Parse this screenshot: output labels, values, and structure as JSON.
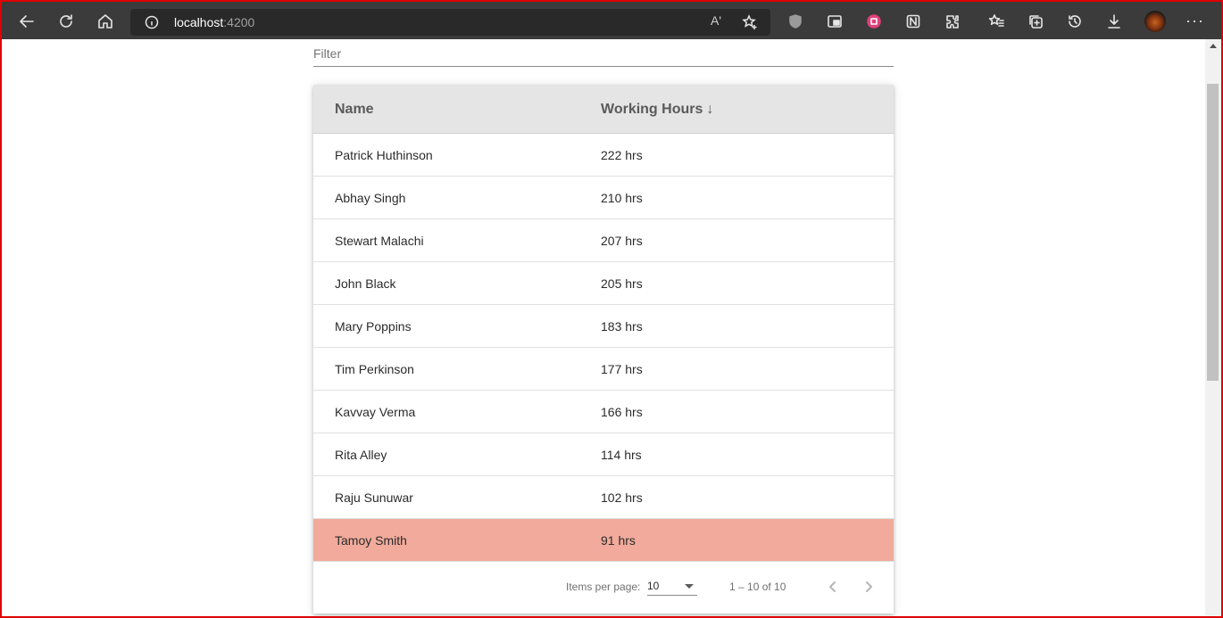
{
  "browser": {
    "url_host": "localhost",
    "url_port": ":4200",
    "read_aloud_label": "Aʹ",
    "menu_label": "···",
    "icons": [
      "back-icon",
      "refresh-icon",
      "home-icon",
      "info-icon",
      "add-favorite-icon",
      "ublock-icon",
      "media-icon",
      "extension-pink-icon",
      "notion-icon",
      "extensions-icon",
      "favorites-icon",
      "collections-icon",
      "history-icon",
      "downloads-icon",
      "profile-avatar",
      "more-icon"
    ]
  },
  "filter": {
    "placeholder": "Filter"
  },
  "table": {
    "headers": {
      "name": "Name",
      "hours": "Working Hours",
      "sort_indicator": "↓"
    },
    "rows": [
      {
        "name": "Patrick Huthinson",
        "hours": "222 hrs",
        "highlight": false
      },
      {
        "name": "Abhay Singh",
        "hours": "210 hrs",
        "highlight": false
      },
      {
        "name": "Stewart Malachi",
        "hours": "207 hrs",
        "highlight": false
      },
      {
        "name": "John Black",
        "hours": "205 hrs",
        "highlight": false
      },
      {
        "name": "Mary Poppins",
        "hours": "183 hrs",
        "highlight": false
      },
      {
        "name": "Tim Perkinson",
        "hours": "177 hrs",
        "highlight": false
      },
      {
        "name": "Kavvay Verma",
        "hours": "166 hrs",
        "highlight": false
      },
      {
        "name": "Rita Alley",
        "hours": "114 hrs",
        "highlight": false
      },
      {
        "name": "Raju Sunuwar",
        "hours": "102 hrs",
        "highlight": false
      },
      {
        "name": "Tamoy Smith",
        "hours": "91 hrs",
        "highlight": true
      }
    ]
  },
  "paginator": {
    "items_per_page_label": "Items per page:",
    "page_size": "10",
    "range_label": "1 – 10 of 10"
  },
  "colors": {
    "highlight_row": "#f1aa9b",
    "header_bg": "#e5e5e5",
    "frame_border": "#e00000"
  }
}
